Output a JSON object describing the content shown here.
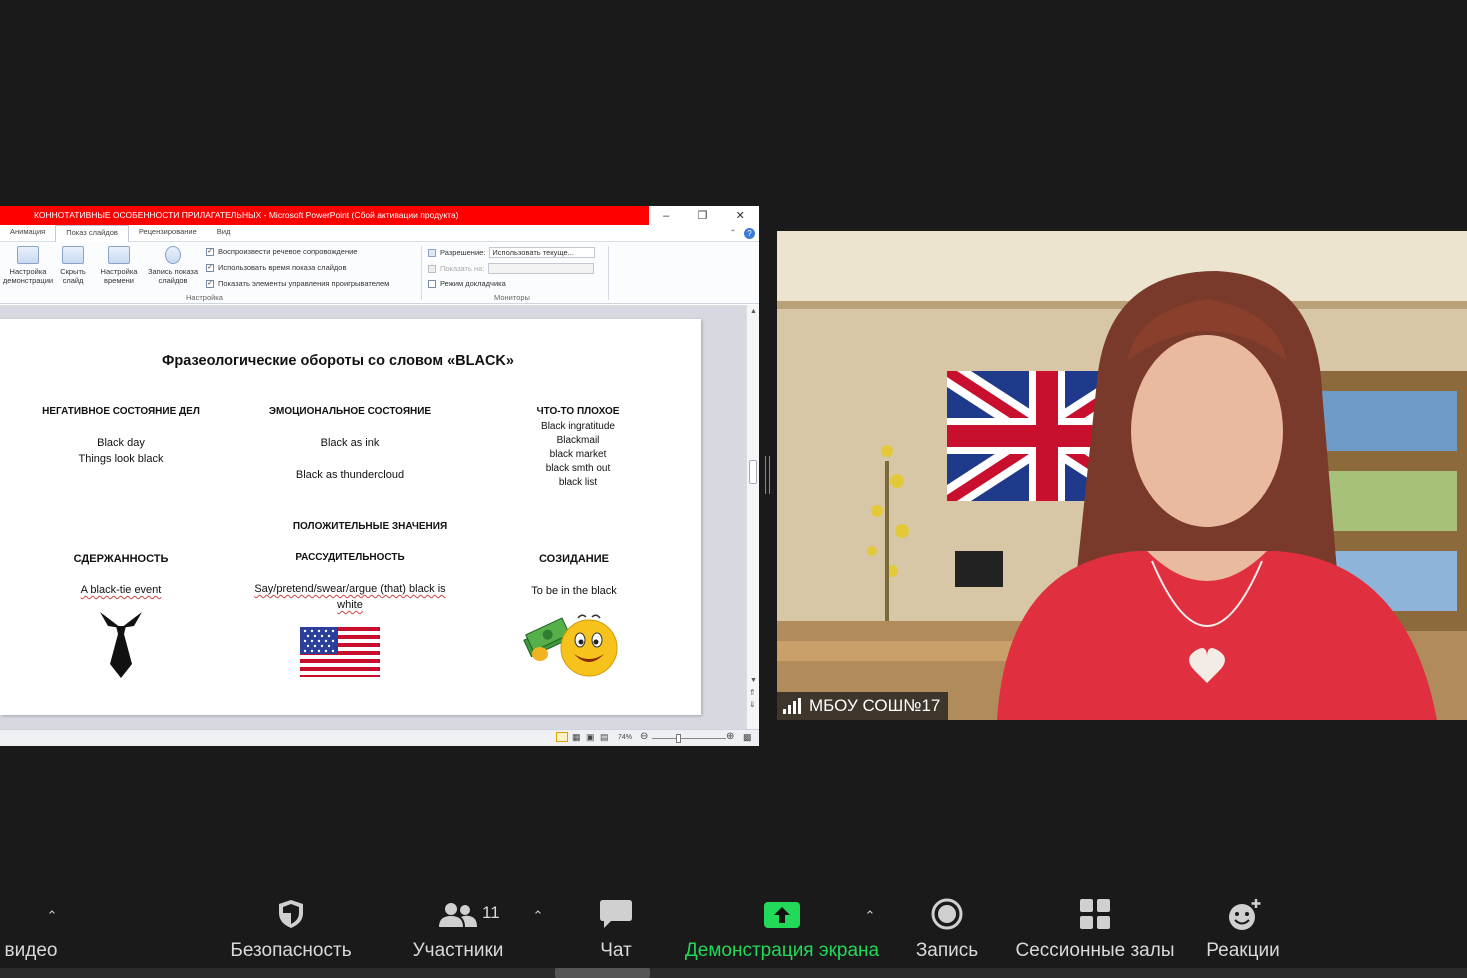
{
  "ppt": {
    "window_title": "КОННОТАТИВНЫЕ ОСОБЕННОСТИ ПРИЛАГАТЕЛЬНЫХ  -  Microsoft PowerPoint (Сбой активации продукта)",
    "tabs": [
      "Анимация",
      "Показ слайдов",
      "Рецензирование",
      "Вид"
    ],
    "ribbon": {
      "btn1": "Настройка демонстрации",
      "btn2": "Скрыть слайд",
      "btn3": "Настройка времени",
      "btn4": "Запись показа слайдов",
      "check1": "Воспроизвести речевое сопровождение",
      "check2": "Использовать время показа слайдов",
      "check3": "Показать элементы управления проигрывателем",
      "group1": "Настройка",
      "resolution_label": "Разрешение:",
      "resolution_value": "Использовать текуще...",
      "show_on_label": "Показать на:",
      "presenter_mode": "Режим докладчика",
      "group2": "Мониторы"
    },
    "zoom_level": "74%"
  },
  "slide": {
    "title": "Фразеологические обороты со словом «BLACK»",
    "col1_head": "НЕГАТИВНОЕ СОСТОЯНИЕ ДЕЛ",
    "col1_line1": "Black day",
    "col1_line2": "Things look black",
    "col2_head": "ЭМОЦИОНАЛЬНОЕ СОСТОЯНИЕ",
    "col2_line1": "Black as ink",
    "col2_line2": "Black as  thundercloud",
    "col3_head": "ЧТО-ТО ПЛОХОЕ",
    "col3_lines": [
      "Black ingratitude",
      "Blackmail",
      "black market",
      "black smth out",
      "black list"
    ],
    "positive_head": "ПОЛОЖИТЕЛЬНЫЕ ЗНАЧЕНИЯ",
    "pos1_head": "СДЕРЖАННОСТЬ",
    "pos1_line": "A black-tie event",
    "pos2_head": "РАССУДИТЕЛЬНОСТЬ",
    "pos2_line": "Say/pretend/swear/argue (that) black is white",
    "pos3_head": "СОЗИДАНИЕ",
    "pos3_line": "To be in the black"
  },
  "video": {
    "participant_name": "МБОУ СОШ№17"
  },
  "toolbar": {
    "video_label": "видео",
    "security_label": "Безопасность",
    "participants_label": "Участники",
    "participants_count": "11",
    "chat_label": "Чат",
    "share_label": "Демонстрация экрана",
    "record_label": "Запись",
    "breakout_label": "Сессионные залы",
    "reactions_label": "Реакции",
    "share_color": "#23d959",
    "text_color": "#d9d9d9"
  }
}
